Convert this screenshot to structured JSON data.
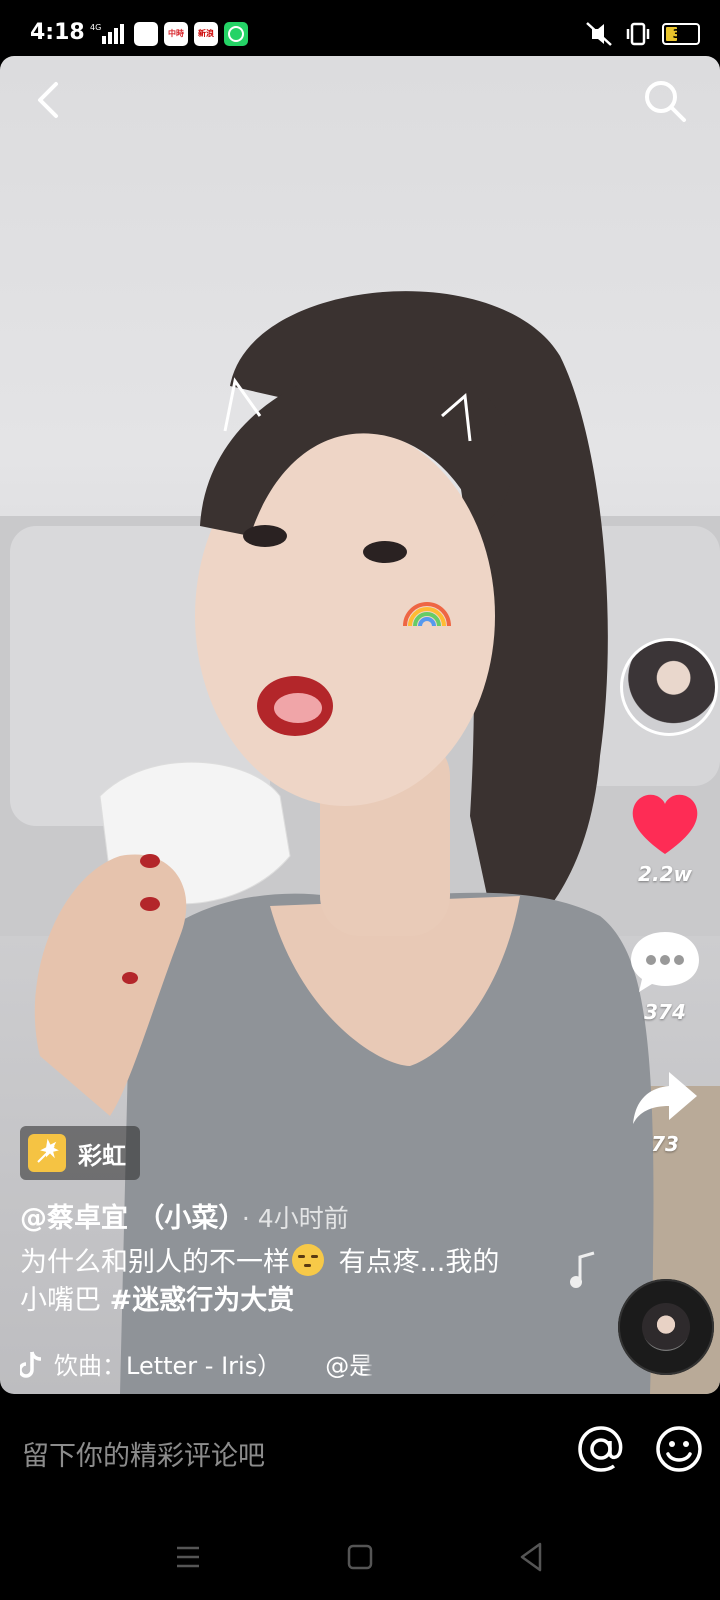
{
  "status_bar": {
    "time": "4:18",
    "network": "4G",
    "apps": [
      {
        "name": "app-1",
        "label": "",
        "color": "#ffffff"
      },
      {
        "name": "app-2",
        "label": "中時",
        "color": "#d8262c"
      },
      {
        "name": "app-3",
        "label": "新浪",
        "color": "#ffffff"
      },
      {
        "name": "whatsapp",
        "label": "",
        "color": "#25d366"
      }
    ],
    "battery": "37"
  },
  "video": {
    "effect_label": "彩虹",
    "author": "@蔡卓宜 （小菜）",
    "time_ago": "· 4小时前",
    "caption_part1": "为什么和别人的不一样",
    "caption_part2": " 有点疼...我的小嘴巴 ",
    "hashtag": "#迷惑行为大赏",
    "music": "饮曲：Letter - Iris）",
    "music_extra": "@是"
  },
  "rail": {
    "likes": "2.2w",
    "comments": "374",
    "shares": "73"
  },
  "comment_bar": {
    "placeholder": "留下你的精彩评论吧"
  },
  "colors": {
    "like": "#fe2c55",
    "effect_badge": "#f5c343"
  }
}
